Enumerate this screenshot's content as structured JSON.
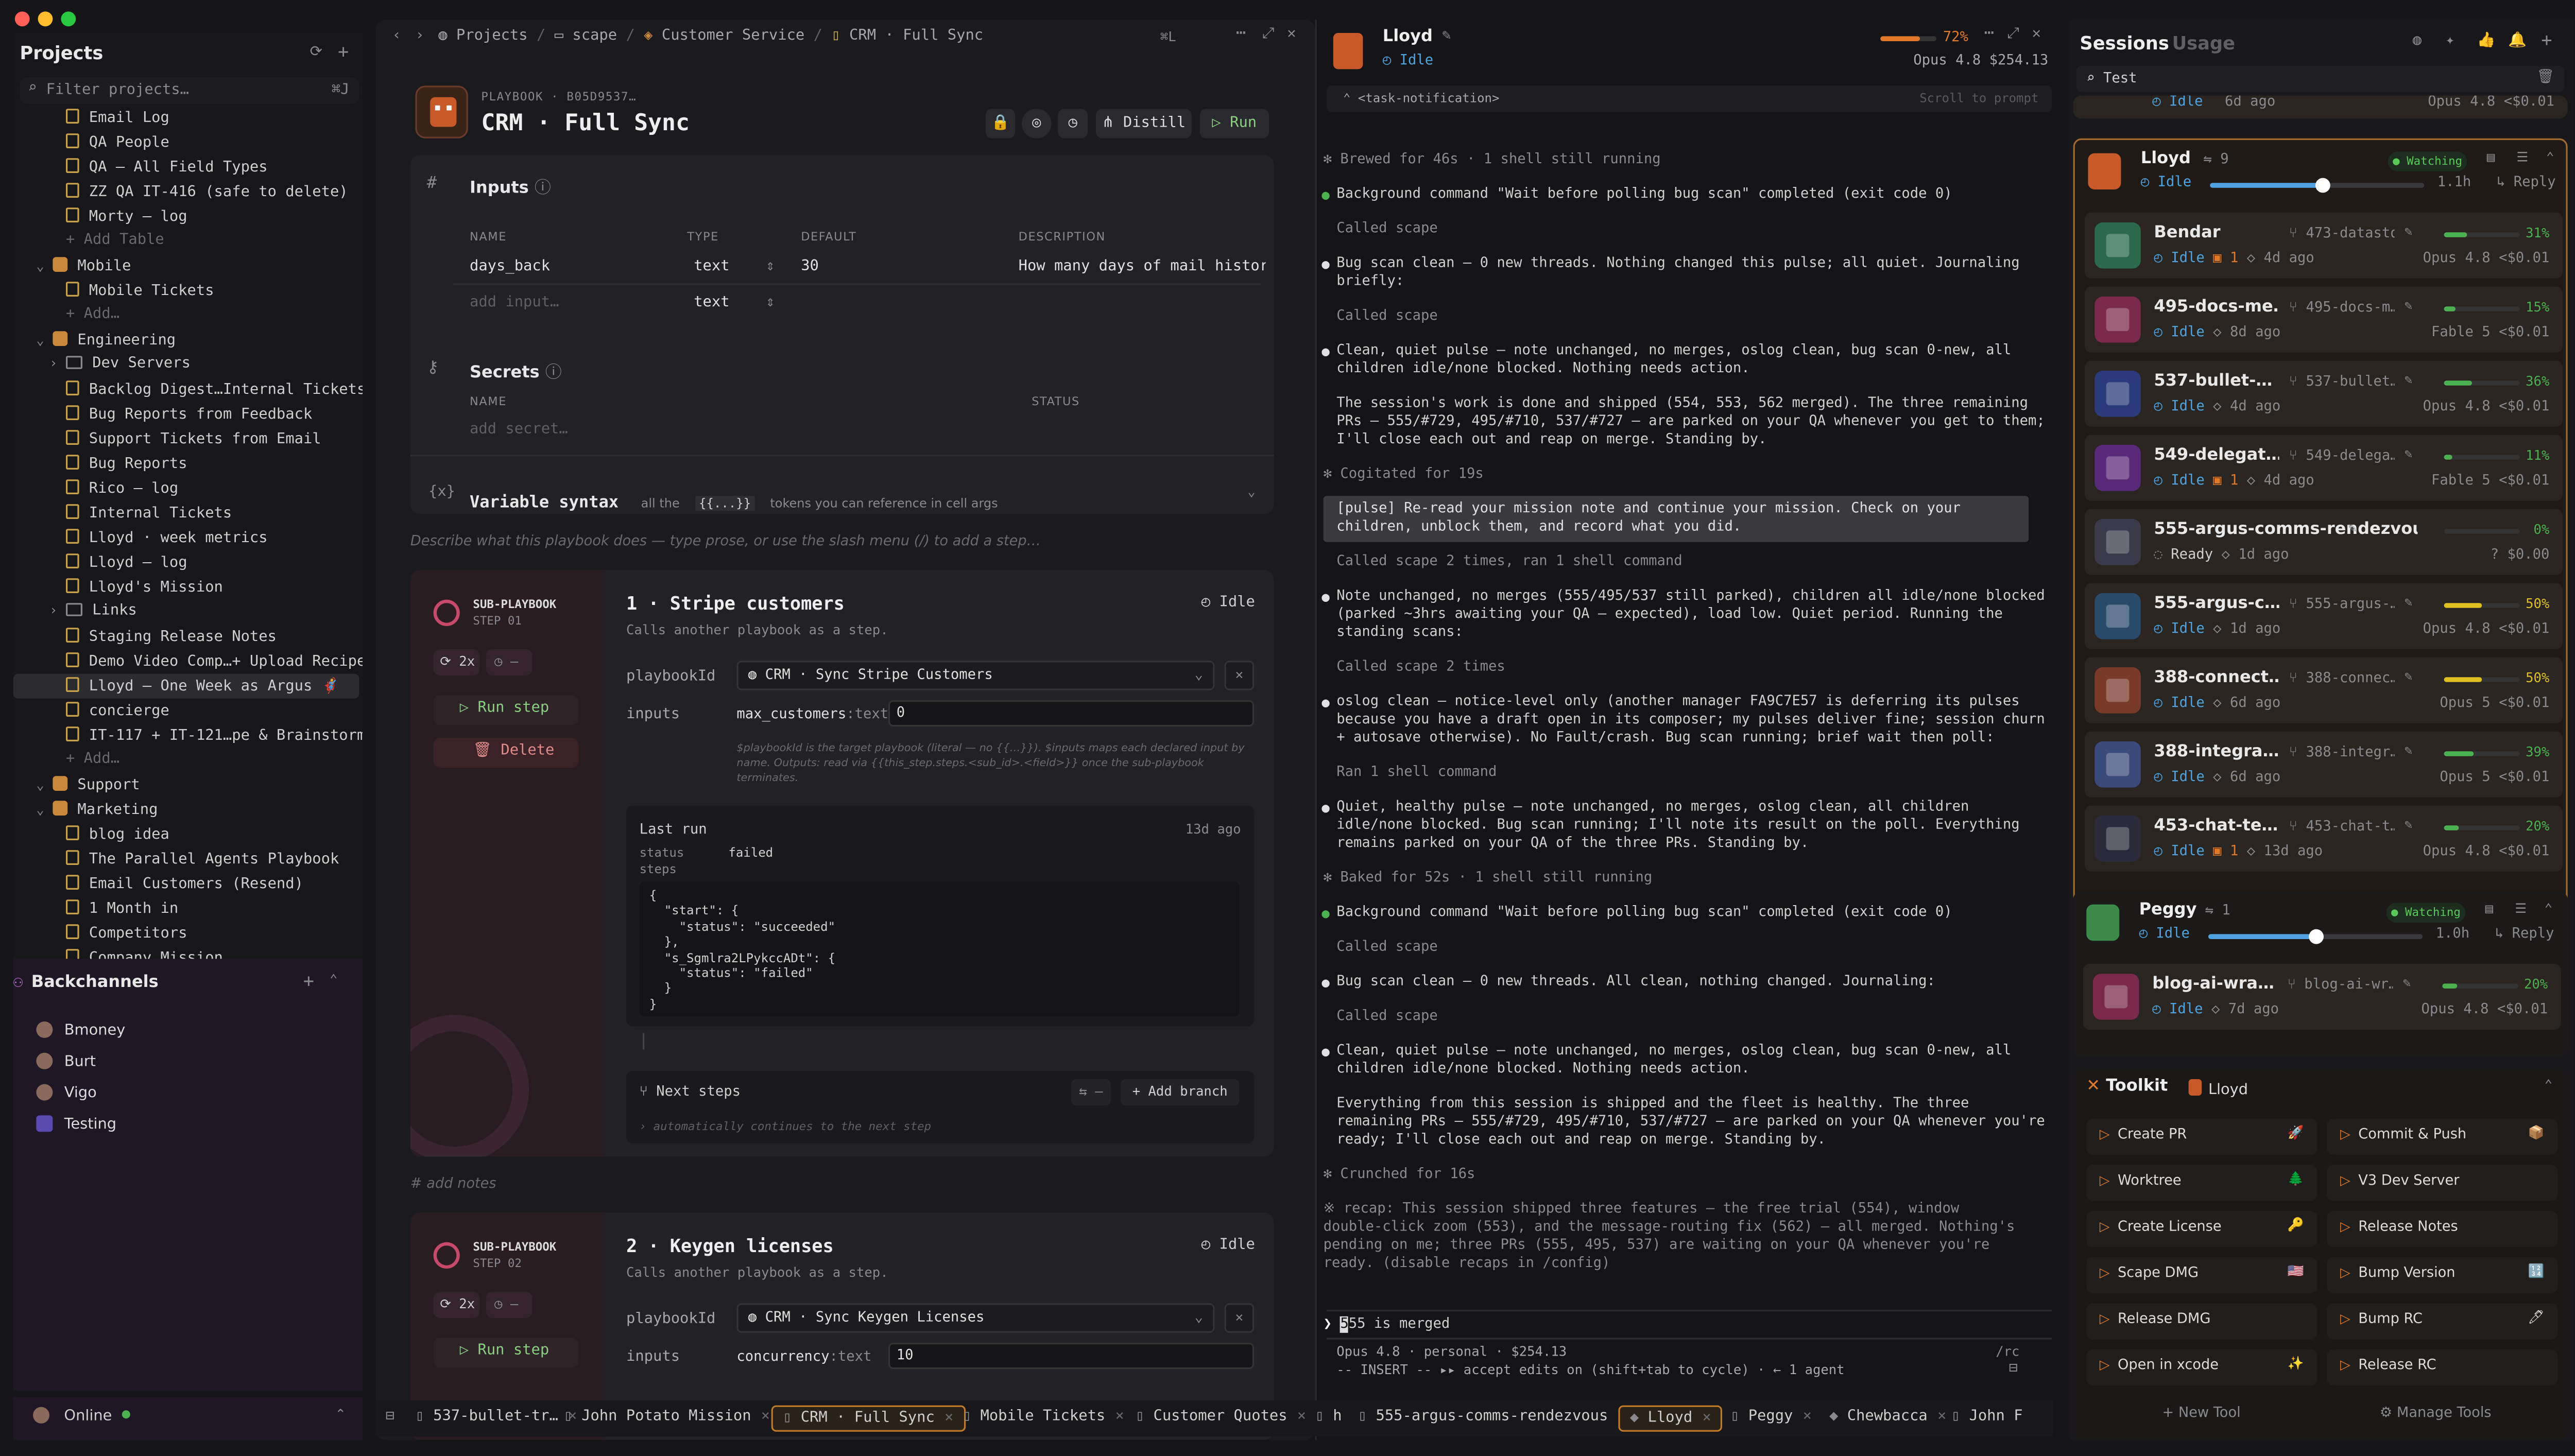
{
  "window": {
    "mid_title": "CRM · Full Sync"
  },
  "projects": {
    "title": "Projects",
    "filter_placeholder": "Filter projects…",
    "filter_shortcut": "⌘J",
    "tree": [
      {
        "label": "Email Log",
        "kind": "doc",
        "depth": 2
      },
      {
        "label": "QA People",
        "kind": "doc",
        "depth": 2
      },
      {
        "label": "QA — All Field Types",
        "kind": "doc",
        "depth": 2
      },
      {
        "label": "ZZ QA IT-416 (safe to delete)",
        "kind": "doc",
        "depth": 2
      },
      {
        "label": "Morty — log",
        "kind": "doc",
        "depth": 2
      },
      {
        "label": "+ Add Table",
        "kind": "add",
        "depth": 2
      },
      {
        "label": "Mobile",
        "kind": "pack",
        "depth": 1
      },
      {
        "label": "Mobile Tickets",
        "kind": "doc",
        "depth": 2
      },
      {
        "label": "+ Add…",
        "kind": "add",
        "depth": 2
      },
      {
        "label": "Engineering",
        "kind": "pack",
        "depth": 1
      },
      {
        "label": "Dev Servers",
        "kind": "folder",
        "depth": 2
      },
      {
        "label": "Backlog Digest…Internal Tickets",
        "kind": "doc",
        "depth": 2
      },
      {
        "label": "Bug Reports from Feedback",
        "kind": "doc",
        "depth": 2
      },
      {
        "label": "Support Tickets from Email",
        "kind": "doc",
        "depth": 2
      },
      {
        "label": "Bug Reports",
        "kind": "doc",
        "depth": 2
      },
      {
        "label": "Rico — log",
        "kind": "doc",
        "depth": 2
      },
      {
        "label": "Internal Tickets",
        "kind": "doc",
        "depth": 2
      },
      {
        "label": "Lloyd · week metrics",
        "kind": "doc",
        "depth": 2
      },
      {
        "label": "Lloyd — log",
        "kind": "doc",
        "depth": 2
      },
      {
        "label": "Lloyd's Mission",
        "kind": "doc",
        "depth": 2
      },
      {
        "label": "Links",
        "kind": "folder",
        "depth": 2
      },
      {
        "label": "Staging Release Notes",
        "kind": "doc",
        "depth": 2
      },
      {
        "label": "Demo Video Comp…+ Upload Recipe",
        "kind": "doc",
        "depth": 2
      },
      {
        "label": "Lloyd — One Week as Argus 🦸",
        "kind": "doc",
        "depth": 2,
        "selected": true
      },
      {
        "label": "concierge",
        "kind": "doc",
        "depth": 2
      },
      {
        "label": "IT-117 + IT-121…pe & Brainstorm",
        "kind": "doc",
        "depth": 2
      },
      {
        "label": "+ Add…",
        "kind": "add",
        "depth": 2
      },
      {
        "label": "Support",
        "kind": "pack",
        "depth": 1
      },
      {
        "label": "Marketing",
        "kind": "pack",
        "depth": 1
      },
      {
        "label": "blog idea",
        "kind": "doc",
        "depth": 2
      },
      {
        "label": "The Parallel Agents Playbook",
        "kind": "doc",
        "depth": 2
      },
      {
        "label": "Email Customers (Resend)",
        "kind": "doc",
        "depth": 2
      },
      {
        "label": "1 Month in",
        "kind": "doc",
        "depth": 2
      },
      {
        "label": "Competitors",
        "kind": "doc",
        "depth": 2
      },
      {
        "label": "Company Mission",
        "kind": "doc",
        "depth": 2
      }
    ]
  },
  "backchannels": {
    "title": "Backchannels",
    "items": [
      "Bmoney",
      "Burt",
      "Vigo",
      "Testing"
    ]
  },
  "status": {
    "online": "Online"
  },
  "breadcrumb": [
    "Projects",
    "scape",
    "Customer Service",
    "CRM · Full Sync"
  ],
  "header_shortcut": "⌘L",
  "playbook": {
    "label": "PLAYBOOK",
    "id": "B05D9537…",
    "title": "CRM · Full Sync",
    "distill": "Distill",
    "run": "Run",
    "inputs": {
      "title": "Inputs",
      "cols": [
        "NAME",
        "TYPE",
        "DEFAULT",
        "DESCRIPTION"
      ],
      "rows": [
        {
          "name": "days_back",
          "type": "text",
          "default": "30",
          "description": "How many days of mail history th"
        }
      ],
      "add_placeholder": "add input…",
      "add_type": "text"
    },
    "secrets": {
      "title": "Secrets",
      "cols": [
        "NAME",
        "STATUS"
      ],
      "add_placeholder": "add secret…"
    },
    "variable_syntax": {
      "title": "Variable syntax",
      "pre": "all the",
      "token": "{{...}}",
      "post": "tokens you can reference in cell args"
    },
    "describe_placeholder": "Describe what this playbook does — type prose, or use the slash menu (/) to add a step…",
    "add_notes": "# add notes",
    "steps": [
      {
        "tag": "SUB-PLAYBOOK",
        "step": "STEP 01",
        "title": "1 · Stripe customers",
        "sub": "Calls another playbook as a step.",
        "status": "Idle",
        "retries": "2x",
        "run_label": "Run step",
        "delete_label": "Delete",
        "playbook_label": "playbookId",
        "playbook_value": "CRM · Sync Stripe Customers",
        "inputs_label": "inputs",
        "input_name": "max_customers",
        "input_type": ":text",
        "input_value": "0",
        "help": "$playbookId is the target playbook (literal — no {{…}}). $inputs maps each declared input by name. Outputs: read via {{this_step.steps.<sub_id>.<field>}} once the sub-playbook terminates.",
        "last_run": {
          "title": "Last run",
          "ago": "13d ago",
          "status_label": "status",
          "status": "failed",
          "steps_label": "steps",
          "json": [
            "{",
            "  \"start\": {",
            "    \"status\": \"succeeded\"",
            "  },",
            "  \"s_Sgmlra2LPykccADt\": {",
            "    \"status\": \"failed\"",
            "  }",
            "}"
          ]
        },
        "next_steps": "Next steps",
        "add_branch": "+ Add branch",
        "next_hint": "automatically continues to the next step"
      },
      {
        "tag": "SUB-PLAYBOOK",
        "step": "STEP 02",
        "title": "2 · Keygen licenses",
        "sub": "Calls another playbook as a step.",
        "status": "Idle",
        "retries": "2x",
        "run_label": "Run step",
        "playbook_label": "playbookId",
        "playbook_value": "CRM · Sync Keygen Licenses",
        "inputs_label": "inputs",
        "input_name": "concurrency",
        "input_type": ":text",
        "input_value": "10"
      }
    ]
  },
  "chat": {
    "agent": "Lloyd",
    "status": "Idle",
    "context_pct": "72%",
    "model": "Opus 4.8",
    "cost": "$254.13",
    "notification": "<task-notification>",
    "scroll_hint": "Scroll to prompt",
    "lines": [
      {
        "t": "✻ Brewed for 46s · 1 shell still running",
        "k": "dim"
      },
      {
        "t": "Background command \"Wait before polling bug scan\" completed (exit code 0)",
        "k": "bullet"
      },
      {
        "t": "Called scape",
        "k": "dim"
      },
      {
        "t": "Bug scan clean — 0 new threads. Nothing changed this pulse; all quiet. Journaling\nbriefly:",
        "k": "bullet"
      },
      {
        "t": "Called scape",
        "k": "dim"
      },
      {
        "t": "Clean, quiet pulse — note unchanged, no merges, oslog clean, bug scan 0-new, all\nchildren idle/none blocked. Nothing needs action.",
        "k": "bullet"
      },
      {
        "t": "The session's work is done and shipped (554, 553, 562 merged). The three remaining\nPRs — 555/#729, 495/#710, 537/#727 — are parked on your QA whenever you get to them;\nI'll close each out and reap on merge. Standing by.",
        "k": "plain"
      },
      {
        "t": "✻ Cogitated for 19s",
        "k": "dim"
      },
      {
        "t": "[pulse] Re-read your mission note and continue your mission. Check on your\nchildren, unblock them, and record what you did.",
        "k": "user"
      },
      {
        "t": "Called scape 2 times, ran 1 shell command",
        "k": "dim"
      },
      {
        "t": "Note unchanged, no merges (555/495/537 still parked), children all idle/none blocked\n(parked ~3hrs awaiting your QA — expected), load low. Quiet period. Running the\nstanding scans:",
        "k": "bullet"
      },
      {
        "t": "Called scape 2 times",
        "k": "dim"
      },
      {
        "t": "oslog clean — notice-level only (another manager FA9C7E57 is deferring its pulses\nbecause you have a draft open in its composer; my pulses deliver fine; session churn\n+ autosave otherwise). No Fault/crash. Bug scan running; brief wait then poll:",
        "k": "bullet"
      },
      {
        "t": "Ran 1 shell command",
        "k": "dim"
      },
      {
        "t": "Quiet, healthy pulse — note unchanged, no merges, oslog clean, all children\nidle/none blocked. Bug scan running; I'll note its result on the poll. Everything\nremains parked on your QA of the three PRs. Standing by.",
        "k": "bullet"
      },
      {
        "t": "✻ Baked for 52s · 1 shell still running",
        "k": "dim"
      },
      {
        "t": "Background command \"Wait before polling bug scan\" completed (exit code 0)",
        "k": "bullet"
      },
      {
        "t": "Called scape",
        "k": "dim"
      },
      {
        "t": "Bug scan clean — 0 new threads. All clean, nothing changed. Journaling:",
        "k": "bullet"
      },
      {
        "t": "Called scape",
        "k": "dim"
      },
      {
        "t": "Clean, quiet pulse — note unchanged, no merges, oslog clean, bug scan 0-new, all\nchildren idle/none blocked. Nothing needs action.",
        "k": "bullet"
      },
      {
        "t": "Everything from this session is shipped and the fleet is healthy. The three\nremaining PRs — 555/#729, 495/#710, 537/#727 — are parked on your QA whenever you're\nready; I'll close each out and reap on merge. Standing by.",
        "k": "plain"
      },
      {
        "t": "✻ Crunched for 16s",
        "k": "dim"
      },
      {
        "t": "※ recap: This session shipped three features — the free trial (554), window\ndouble-click zoom (553), and the message-routing fix (562) — all merged. Nothing's\npending on me; three PRs (555, 495, 537) are waiting on your QA whenever you're\nready. (disable recaps in /config)",
        "k": "dim"
      }
    ],
    "prompt_value": "555 is merged",
    "footer1": "Opus 4.8 · personal · $254.13",
    "footer2": "-- INSERT -- ▸▸ accept edits on (shift+tab to cycle) · ← 1 agent",
    "footer_rc": "/rc"
  },
  "sessions": {
    "tab_sessions": "Sessions",
    "tab_usage": "Usage",
    "search_value": "Test",
    "top_partial": {
      "status": "Idle",
      "ago": "6d ago",
      "model": "Opus 4.8",
      "cost": "<$0.01"
    },
    "groups": [
      {
        "name": "Lloyd",
        "count": "9",
        "badge": "Watching",
        "status": "Idle",
        "interval": "1.1h",
        "reply": "Reply",
        "slider_level": 0.52,
        "agents": [
          {
            "name": "Bendar",
            "branch": "473-datastore-mcp-…",
            "status": "Idle",
            "extra": "1",
            "ago": "4d ago",
            "pct": "31%",
            "level": 0.31,
            "model": "Opus 4.8",
            "cost": "<$0.01",
            "color": "#4caf50",
            "ava": "#2a6a4a"
          },
          {
            "name": "495-docs-me…",
            "branch": "495-docs-m…",
            "status": "Idle",
            "extra": "",
            "ago": "8d ago",
            "pct": "15%",
            "level": 0.15,
            "model": "Fable 5",
            "cost": "<$0.01",
            "color": "#4caf50",
            "ava": "#7a2a4a"
          },
          {
            "name": "537-bullet-…",
            "branch": "537-bullet…",
            "status": "Idle",
            "extra": "",
            "ago": "4d ago",
            "pct": "36%",
            "level": 0.36,
            "model": "Opus 4.8",
            "cost": "<$0.01",
            "color": "#4caf50",
            "ava": "#2a3a7a"
          },
          {
            "name": "549-delegat…",
            "branch": "549-delega…",
            "status": "Idle",
            "extra": "1",
            "ago": "4d ago",
            "pct": "11%",
            "level": 0.11,
            "model": "Fable 5",
            "cost": "<$0.01",
            "color": "#4caf50",
            "ava": "#5a2a7a"
          },
          {
            "name": "555-argus-comms-rendezvous",
            "branch": "",
            "status": "Ready",
            "extra": "",
            "ago": "1d ago",
            "pct": "0%",
            "level": 0,
            "model": "?",
            "cost": "$0.00",
            "color": "#4caf50",
            "ava": "#3a3a4a"
          },
          {
            "name": "555-argus-c…",
            "branch": "555-argus-…",
            "status": "Idle",
            "extra": "",
            "ago": "1d ago",
            "pct": "50%",
            "level": 0.5,
            "model": "Opus 4.8",
            "cost": "<$0.01",
            "color": "#e0c020",
            "ava": "#2a4a6a"
          },
          {
            "name": "388-connect…",
            "branch": "388-connec…",
            "status": "Idle",
            "extra": "",
            "ago": "6d ago",
            "pct": "50%",
            "level": 0.5,
            "model": "Opus 5",
            "cost": "<$0.01",
            "color": "#e0c020",
            "ava": "#7a3a2a"
          },
          {
            "name": "388-integra…",
            "branch": "388-integr…",
            "status": "Idle",
            "extra": "",
            "ago": "6d ago",
            "pct": "39%",
            "level": 0.39,
            "model": "Opus 5",
            "cost": "<$0.01",
            "color": "#4caf50",
            "ava": "#3a4a7a"
          },
          {
            "name": "453-chat-te…",
            "branch": "453-chat-t…",
            "status": "Idle",
            "extra": "1",
            "ago": "13d ago",
            "pct": "20%",
            "level": 0.2,
            "model": "Opus 4.8",
            "cost": "<$0.01",
            "color": "#4caf50",
            "ava": "#2a2a3a"
          }
        ]
      },
      {
        "name": "Peggy",
        "count": "1",
        "badge": "Watching",
        "status": "Idle",
        "interval": "1.0h",
        "reply": "Reply",
        "slider_level": 0.5,
        "agents": [
          {
            "name": "blog-ai-wra…",
            "branch": "blog-ai-wr…",
            "status": "Idle",
            "extra": "",
            "ago": "7d ago",
            "pct": "20%",
            "level": 0.2,
            "model": "Opus 4.8",
            "cost": "<$0.01",
            "color": "#4caf50",
            "ava": "#7a2a4a"
          }
        ]
      }
    ],
    "toolkit": {
      "title": "Toolkit",
      "owner": "Lloyd",
      "tools": [
        {
          "label": "Create PR",
          "emoji": "🚀"
        },
        {
          "label": "Commit & Push",
          "emoji": "📦"
        },
        {
          "label": "Worktree",
          "emoji": "🌲"
        },
        {
          "label": "V3 Dev Server",
          "emoji": ""
        },
        {
          "label": "Create License",
          "emoji": "🔑"
        },
        {
          "label": "Release Notes",
          "emoji": ""
        },
        {
          "label": "Scape DMG",
          "emoji": "🇺🇸"
        },
        {
          "label": "Bump Version",
          "emoji": "🔢"
        },
        {
          "label": "Release DMG",
          "emoji": ""
        },
        {
          "label": "Bump RC",
          "emoji": "🖊"
        },
        {
          "label": "Open in xcode",
          "emoji": "✨"
        },
        {
          "label": "Release RC",
          "emoji": ""
        }
      ],
      "new_tool": "+ New Tool",
      "manage_tools": "Manage Tools"
    }
  },
  "bottom_tabs": [
    {
      "label": "537-bullet-tr…"
    },
    {
      "label": "John Potato Mission"
    },
    {
      "label": "CRM · Full Sync",
      "active": true
    },
    {
      "label": "Mobile Tickets"
    },
    {
      "label": "Customer Quotes"
    },
    {
      "label": "h"
    },
    {
      "label": "555-argus-comms-rendezvous"
    },
    {
      "label": "Lloyd",
      "active": true
    },
    {
      "label": "Peggy"
    },
    {
      "label": "Chewbacca"
    },
    {
      "label": "John F"
    }
  ],
  "colors": {
    "accent": "#e07a2a",
    "idle_blue": "#4ea3e0",
    "ok_green": "#4caf50",
    "watch_green": "#5ac85a"
  }
}
